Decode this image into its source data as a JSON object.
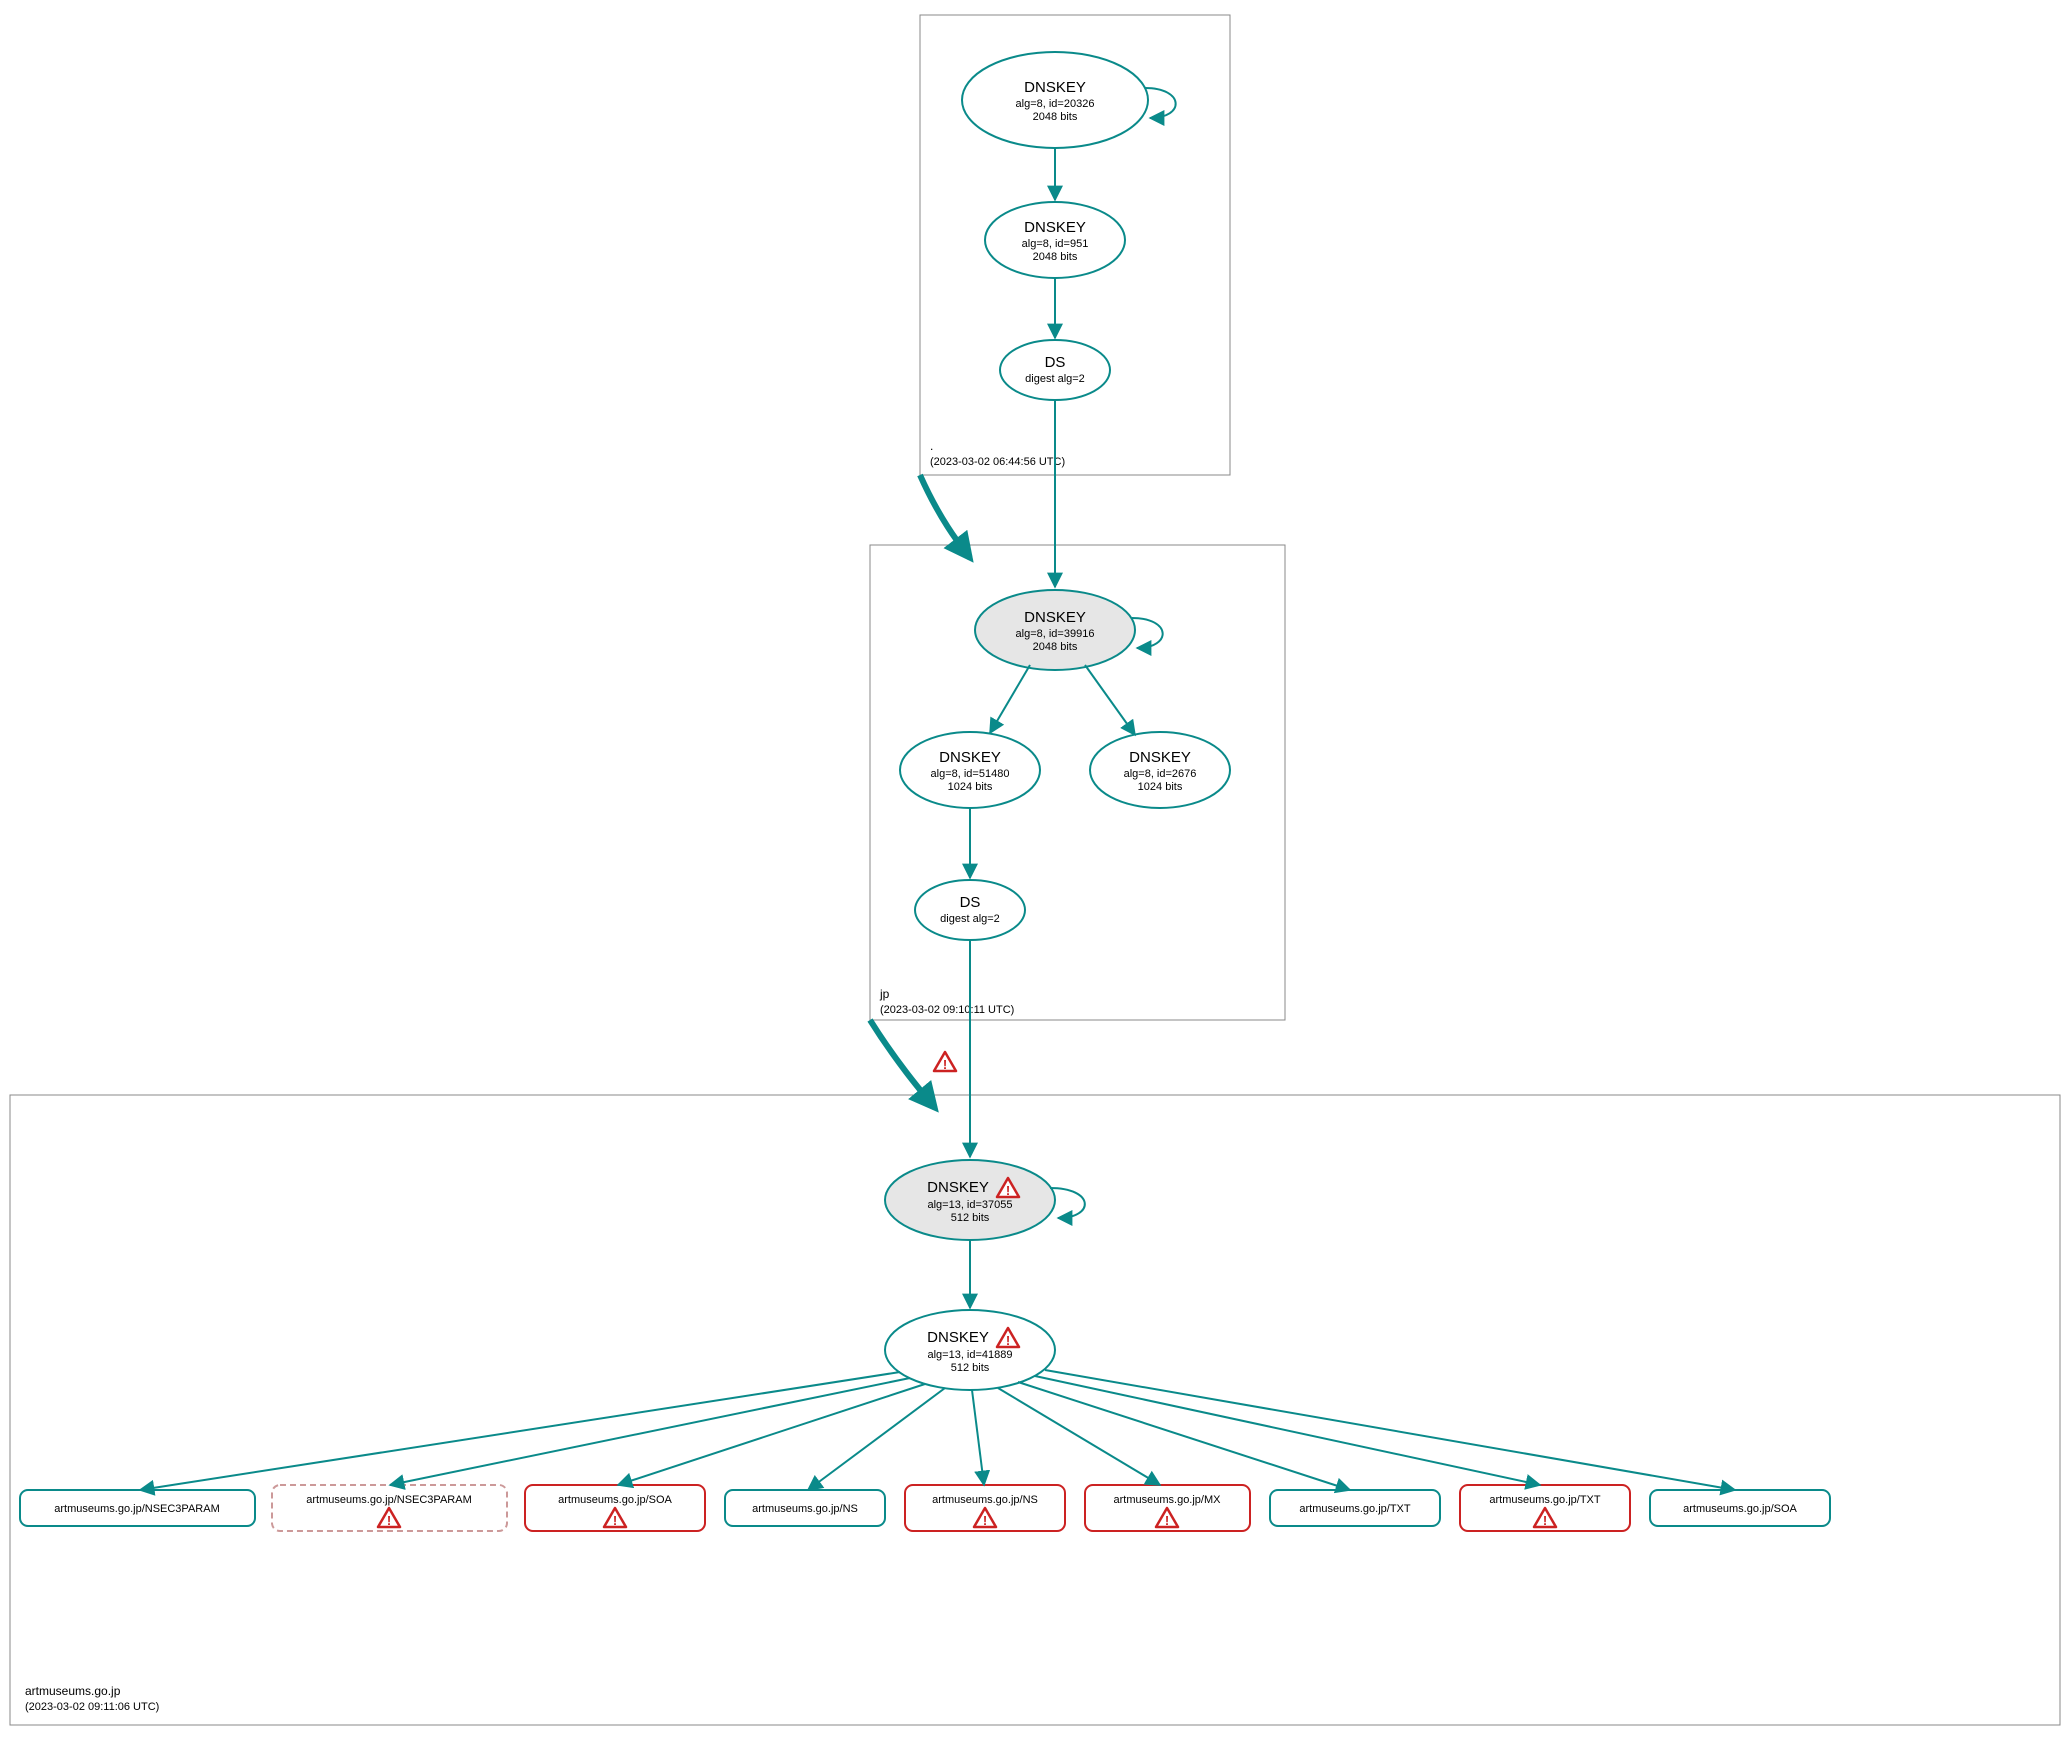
{
  "zones": {
    "root": {
      "label": ".",
      "timestamp": "(2023-03-02 06:44:56 UTC)"
    },
    "jp": {
      "label": "jp",
      "timestamp": "(2023-03-02 09:10:11 UTC)"
    },
    "dom": {
      "label": "artmuseums.go.jp",
      "timestamp": "(2023-03-02 09:11:06 UTC)"
    }
  },
  "nodes": {
    "root_ksk": {
      "title": "DNSKEY",
      "l1": "alg=8, id=20326",
      "l2": "2048 bits"
    },
    "root_zsk": {
      "title": "DNSKEY",
      "l1": "alg=8, id=951",
      "l2": "2048 bits"
    },
    "root_ds": {
      "title": "DS",
      "l1": "digest alg=2",
      "l2": ""
    },
    "jp_ksk": {
      "title": "DNSKEY",
      "l1": "alg=8, id=39916",
      "l2": "2048 bits"
    },
    "jp_zsk": {
      "title": "DNSKEY",
      "l1": "alg=8, id=51480",
      "l2": "1024 bits"
    },
    "jp_zsk2": {
      "title": "DNSKEY",
      "l1": "alg=8, id=2676",
      "l2": "1024 bits"
    },
    "jp_ds": {
      "title": "DS",
      "l1": "digest alg=2",
      "l2": ""
    },
    "dom_ksk": {
      "title": "DNSKEY",
      "l1": "alg=13, id=37055",
      "l2": "512 bits"
    },
    "dom_zsk": {
      "title": "DNSKEY",
      "l1": "alg=13, id=41889",
      "l2": "512 bits"
    },
    "rr1": {
      "label": "artmuseums.go.jp/NSEC3PARAM"
    },
    "rr2": {
      "label": "artmuseums.go.jp/NSEC3PARAM"
    },
    "rr3": {
      "label": "artmuseums.go.jp/SOA"
    },
    "rr4": {
      "label": "artmuseums.go.jp/NS"
    },
    "rr5": {
      "label": "artmuseums.go.jp/NS"
    },
    "rr6": {
      "label": "artmuseums.go.jp/MX"
    },
    "rr7": {
      "label": "artmuseums.go.jp/TXT"
    },
    "rr8": {
      "label": "artmuseums.go.jp/TXT"
    },
    "rr9": {
      "label": "artmuseums.go.jp/SOA"
    }
  }
}
